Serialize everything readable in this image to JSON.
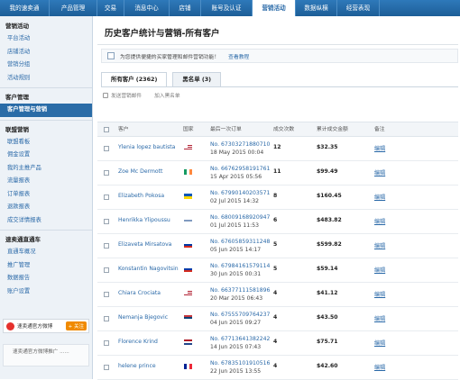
{
  "topnav": [
    "我的速卖通",
    "产品管理",
    "交易",
    "消息中心",
    "店铺",
    "账号及认证",
    "营销活动",
    "数据纵横",
    "经营表现"
  ],
  "sidebar": {
    "group1_title": "营销活动",
    "group1": [
      "平台活动",
      "店铺活动",
      "营销分组",
      "活动规则"
    ],
    "group2_title": "客户管理",
    "group2": [
      "客户管理与营销"
    ],
    "group3_title": "联盟营销",
    "group3": [
      "联盟看板",
      "佣金设置",
      "我的主推产品",
      "流量报表",
      "订单报表",
      "退款报表",
      "成交详情报表"
    ],
    "group4_title": "速卖通直通车",
    "group4": [
      "直通车概况",
      "推广管理",
      "数据报告",
      "账户设置"
    ],
    "weibo_text": "速卖通官方微博",
    "follow": "+ 关注",
    "bottom_text": "速卖通官方微博推广 ......"
  },
  "page_title": "历史客户统计与营销-所有客户",
  "notice": {
    "text": "为您提供便捷的买家管理和邮件营销功能！",
    "link": "查看教程"
  },
  "tabs": [
    "所有客户 (2362)",
    "黑名单 (3)"
  ],
  "actions": [
    "发送营销邮件",
    "加入黑名单"
  ],
  "columns": [
    "客户",
    "国家",
    "最后一次订单",
    "成交次数",
    "累计成交金额",
    "备注"
  ],
  "rows": [
    {
      "name": "Ylenia lopez bautista",
      "flag": "US",
      "order": "No. 67303271880710",
      "date": "18 May 2015 00:04",
      "count": "12",
      "amount": "$32.35",
      "edit": "编辑"
    },
    {
      "name": "Zoe Mc Dermott",
      "flag": "IE",
      "order": "No. 66762958191761",
      "date": "15 Apr 2015 05:56",
      "count": "11",
      "amount": "$99.49",
      "edit": "编辑"
    },
    {
      "name": "Elizabeth Pokosa",
      "flag": "UA",
      "order": "No. 67990140203571",
      "date": "02 Jul 2015 14:32",
      "count": "8",
      "amount": "$160.45",
      "edit": "编辑"
    },
    {
      "name": "Henrikka Ylipoussu",
      "flag": "FI",
      "order": "No. 68009168920947",
      "date": "01 Jul 2015 11:53",
      "count": "6",
      "amount": "$483.82",
      "edit": "编辑"
    },
    {
      "name": "Elizaveta Mirsatova",
      "flag": "RU",
      "order": "No. 67605859311248",
      "date": "05 Jun 2015 14:17",
      "count": "5",
      "amount": "$599.82",
      "edit": "编辑"
    },
    {
      "name": "Konstantin Nagovitsin",
      "flag": "RU",
      "order": "No. 67984161579114",
      "date": "30 Jun 2015 00:31",
      "count": "5",
      "amount": "$59.14",
      "edit": "编辑"
    },
    {
      "name": "Chiara Crociata",
      "flag": "US",
      "order": "No. 66377111581896",
      "date": "20 Mar 2015 06:43",
      "count": "4",
      "amount": "$41.12",
      "edit": "编辑"
    },
    {
      "name": "Nemanja Bjegovic",
      "flag": "RS",
      "order": "No. 67555709764237",
      "date": "04 Jun 2015 09:27",
      "count": "4",
      "amount": "$43.50",
      "edit": "编辑"
    },
    {
      "name": "Florence Krind",
      "flag": "NL",
      "order": "No. 67713641382242",
      "date": "14 Jun 2015 07:43",
      "count": "4",
      "amount": "$75.71",
      "edit": "编辑"
    },
    {
      "name": "helene prince",
      "flag": "FR",
      "order": "No. 67835101910516",
      "date": "22 Jun 2015 13:55",
      "count": "4",
      "amount": "$42.60",
      "edit": "编辑"
    }
  ]
}
